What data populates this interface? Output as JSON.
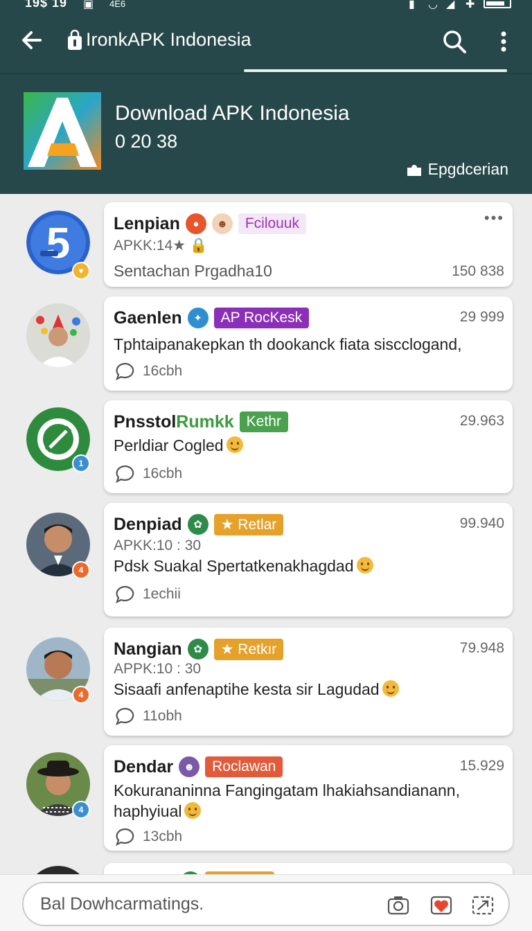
{
  "status_bar": {
    "time": "19$ 19",
    "network": "4E6"
  },
  "app_bar": {
    "title": "IronkAPK Indonesia"
  },
  "header": {
    "name": "Download APK Indonesia",
    "code": "0 20 38",
    "action_label": "Epgdcerian"
  },
  "posts": [
    {
      "username": "Lenpian",
      "mini_icon": "location-pin-icon",
      "tag": "Fcilouuk",
      "meta": "APKK:14★",
      "text": "Sentachan Prgadha10",
      "count": "150 838",
      "badge": "",
      "colors": {
        "tag": "#a22fb6",
        "mini": "#e8552b",
        "badge": "#f2b430"
      }
    },
    {
      "username": "Gaenlen",
      "tag": "AP RocKesk",
      "text": "Tphtaipanakepkan th dookanck fiata siscclogand,",
      "comments": "16cbh",
      "count": "29 999",
      "colors": {
        "tag": "#8b2fb8",
        "mini": "#2f8fd0"
      }
    },
    {
      "username": "PnsstolRumkk",
      "username_green_part": "Rumkk",
      "tag": "Kethr",
      "text": "Perldiar Cogled",
      "comments": "16cbh",
      "count": "29.963",
      "badge": "1",
      "colors": {
        "tag": "#4aa14e",
        "badge": "#3a8fd0"
      }
    },
    {
      "username": "Denpiad",
      "tag": "★ Retlar",
      "meta": "APKK:10 : 30",
      "text": "Pdsk Suakal Spertatkenakhagdad",
      "comments": "1echii",
      "count": "99.940",
      "badge": "4",
      "colors": {
        "tag": "#e5a12a",
        "mini": "#2e8b4a",
        "badge": "#e86a2c"
      }
    },
    {
      "username": "Nangian",
      "tag": "★ Retkır",
      "meta": "APPK:10 : 30",
      "text": "Sisaafi anfenaptihe kesta sir Lagudad",
      "comments": "11obh",
      "count": "79.948",
      "badge": "4",
      "colors": {
        "tag": "#e5a12a",
        "mini": "#2e8b4a",
        "badge": "#e86a2c"
      }
    },
    {
      "username": "Dendar",
      "tag": "Roclawan",
      "text": "Kokurananinna Fangingatam lhakiahsandianann,",
      "text2": "haphyiual",
      "comments": "13cbh",
      "count": "15.929",
      "badge": "4",
      "colors": {
        "tag": "#e25a3a",
        "badge": "#3a8fd0"
      }
    }
  ],
  "composer": {
    "placeholder": "Bal Dowhcarmatings."
  },
  "colors": {
    "appbar": "#27484b",
    "background": "#ececec"
  }
}
